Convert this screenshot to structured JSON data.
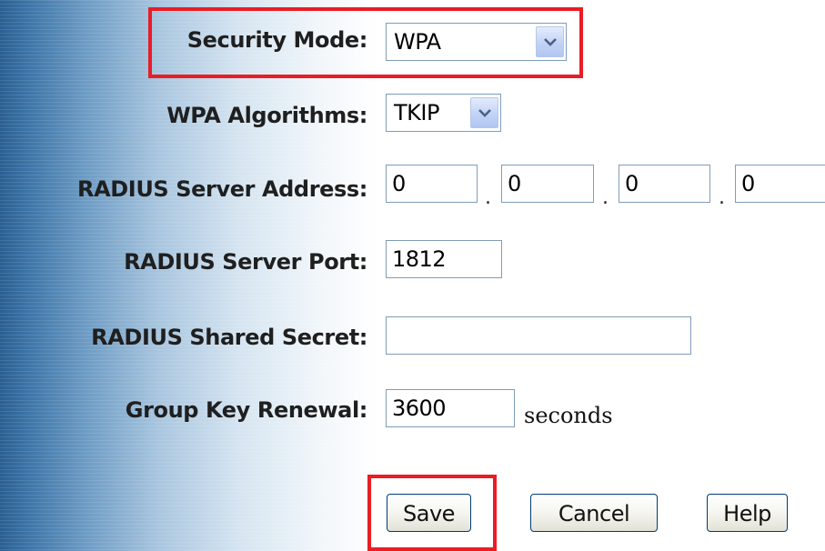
{
  "form": {
    "security_mode": {
      "label": "Security Mode:",
      "value": "WPA"
    },
    "wpa_algorithms": {
      "label": "WPA Algorithms:",
      "value": "TKIP"
    },
    "radius_server_address": {
      "label": "RADIUS Server Address:",
      "octets": [
        "0",
        "0",
        "0",
        "0"
      ],
      "separator": "."
    },
    "radius_server_port": {
      "label": "RADIUS Server Port:",
      "value": "1812"
    },
    "radius_shared_secret": {
      "label": "RADIUS Shared Secret:",
      "value": ""
    },
    "group_key_renewal": {
      "label": "Group Key Renewal:",
      "value": "3600",
      "unit": "seconds"
    }
  },
  "buttons": {
    "save": "Save",
    "cancel": "Cancel",
    "help": "Help"
  },
  "icons": {
    "dropdown": "chevron-down-icon"
  },
  "colors": {
    "highlight": "#ea1c24",
    "input_border": "#7f9db9",
    "dropdown_arrow": "#4d6185",
    "sidebar_dark": "#2a5f91"
  }
}
